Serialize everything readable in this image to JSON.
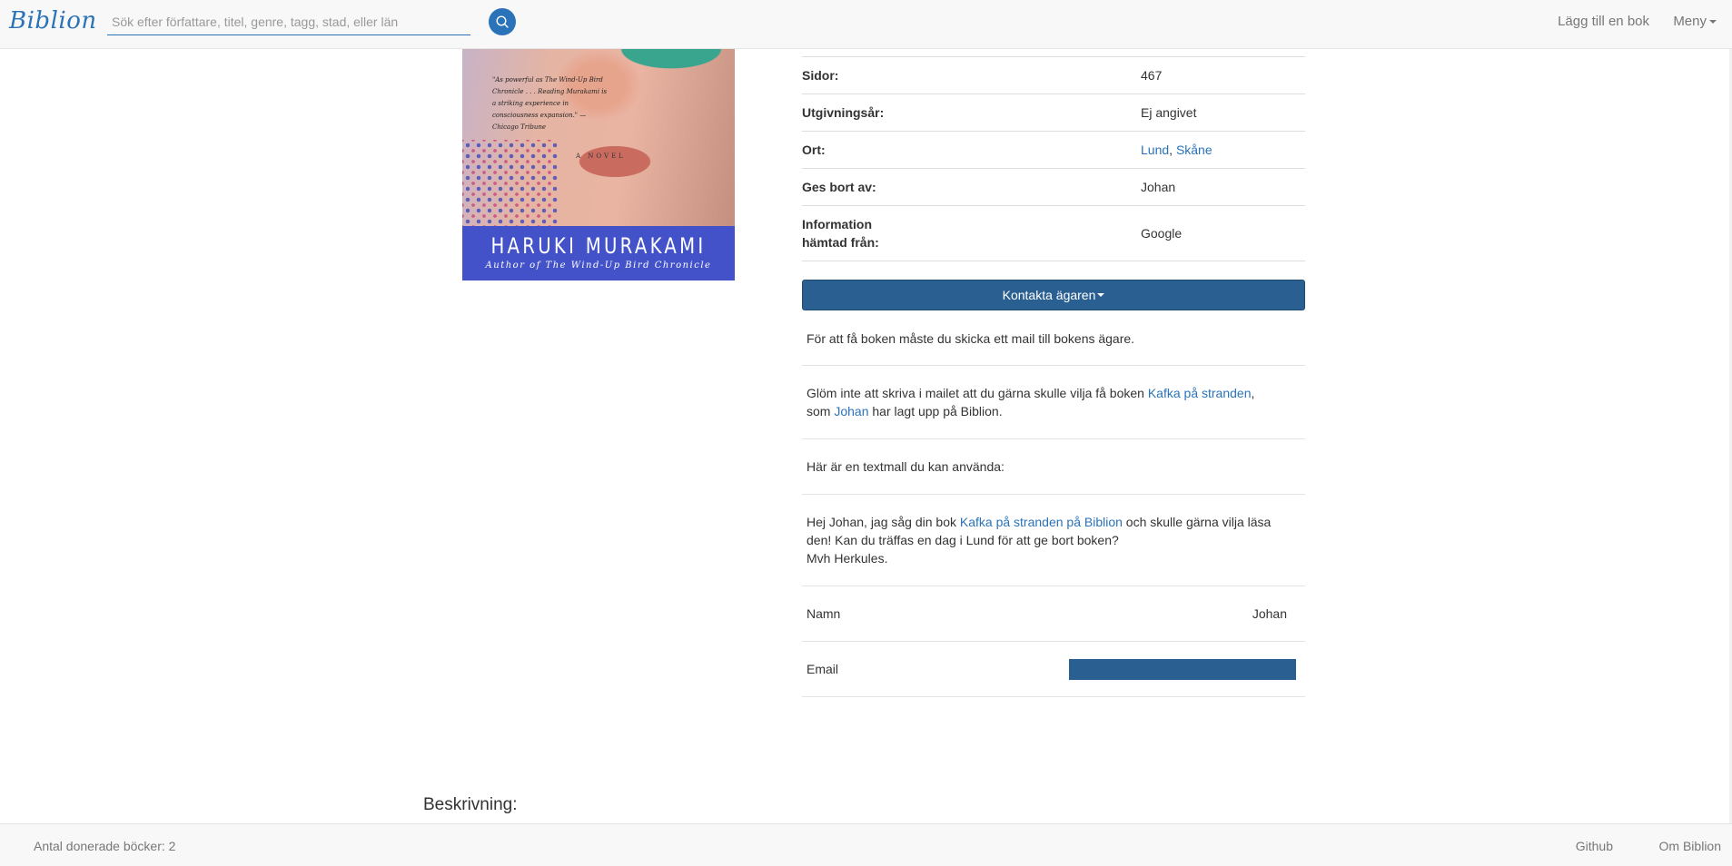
{
  "navbar": {
    "brand": "Biblion",
    "search_placeholder": "Sök efter författare, titel, genre, tagg, stad, eller län",
    "add_book": "Lägg till en bok",
    "menu": "Meny"
  },
  "cover": {
    "quote": "\"As powerful as The Wind-Up Bird Chronicle . . . Reading Murakami is a striking experience in consciousness expansion.\" —Chicago Tribune",
    "novel": "A NOVEL",
    "author": "HARUKI MURAKAMI",
    "subtitle": "Author of The Wind-Up Bird Chronicle",
    "band_color": "#4352c8"
  },
  "details": {
    "pages_label": "Sidor:",
    "pages_value": "467",
    "year_label": "Utgivningsår:",
    "year_value": "Ej angivet",
    "place_label": "Ort:",
    "place_city": "Lund",
    "place_sep": ",",
    "place_region": "Skåne",
    "giver_label": "Ges bort av:",
    "giver_value": "Johan",
    "source_label_1": "Information",
    "source_label_2": "hämtad från:",
    "source_value": "Google"
  },
  "contact": {
    "button_label": "Kontakta ägaren",
    "intro": "För att få boken måste du skicka ett mail till bokens ägare.",
    "reminder_pre": "Glöm inte att skriva i mailet att du gärna skulle vilja få boken ",
    "reminder_book": "Kafka på stranden",
    "reminder_mid": ",",
    "reminder_som": "som ",
    "reminder_owner": "Johan",
    "reminder_post": " har lagt upp på Biblion.",
    "template_intro": "Här är en textmall du kan använda:",
    "template_pre": "Hej Johan, jag såg din bok ",
    "template_link": "Kafka på stranden på Biblion",
    "template_post": " och skulle gärna vilja läsa",
    "template_line2": "den! Kan du träffas en dag i Lund för att ge bort boken?",
    "template_line3": "Mvh Herkules.",
    "name_label": "Namn",
    "name_value": "Johan",
    "email_label": "Email"
  },
  "description_heading": "Beskrivning:",
  "footer": {
    "donated": "Antal donerade böcker: 2",
    "github": "Github",
    "about": "Om Biblion"
  },
  "colors": {
    "accent": "#2a73b8",
    "button": "#2a5f91"
  }
}
